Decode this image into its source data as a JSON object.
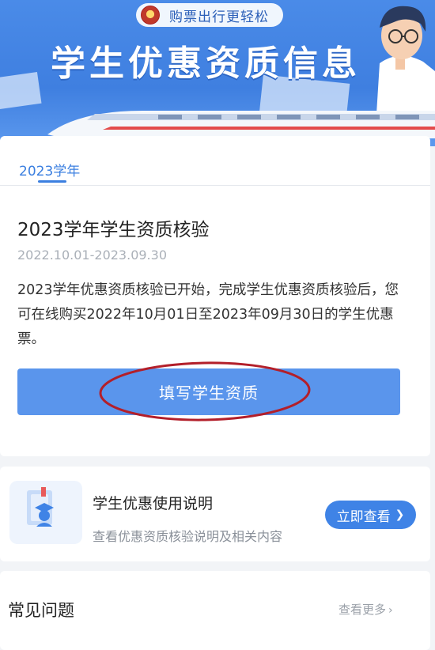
{
  "banner": {
    "tagline": "购票出行更轻松",
    "title": "学生优惠资质信息"
  },
  "year_tab": {
    "label": "2023学年"
  },
  "verification": {
    "title": "2023学年学生资质核验",
    "date_range": "2022.10.01-2023.09.30",
    "description": "2023学年优惠资质核验已开始，完成学生优惠资质核验后，您可在线购买2022年10月01日至2023年09月30日的学生优惠票。",
    "button_label": "填写学生资质"
  },
  "guide": {
    "title": "学生优惠使用说明",
    "subtitle": "查看优惠资质核验说明及相关内容",
    "button_label": "立即查看",
    "icon": "student-guide-icon"
  },
  "faq": {
    "title": "常见问题",
    "more_label": "查看更多"
  },
  "colors": {
    "primary": "#3f83e6",
    "button": "#5a95ec",
    "annotation": "#b31f2a",
    "hero": "#4a8be8"
  }
}
